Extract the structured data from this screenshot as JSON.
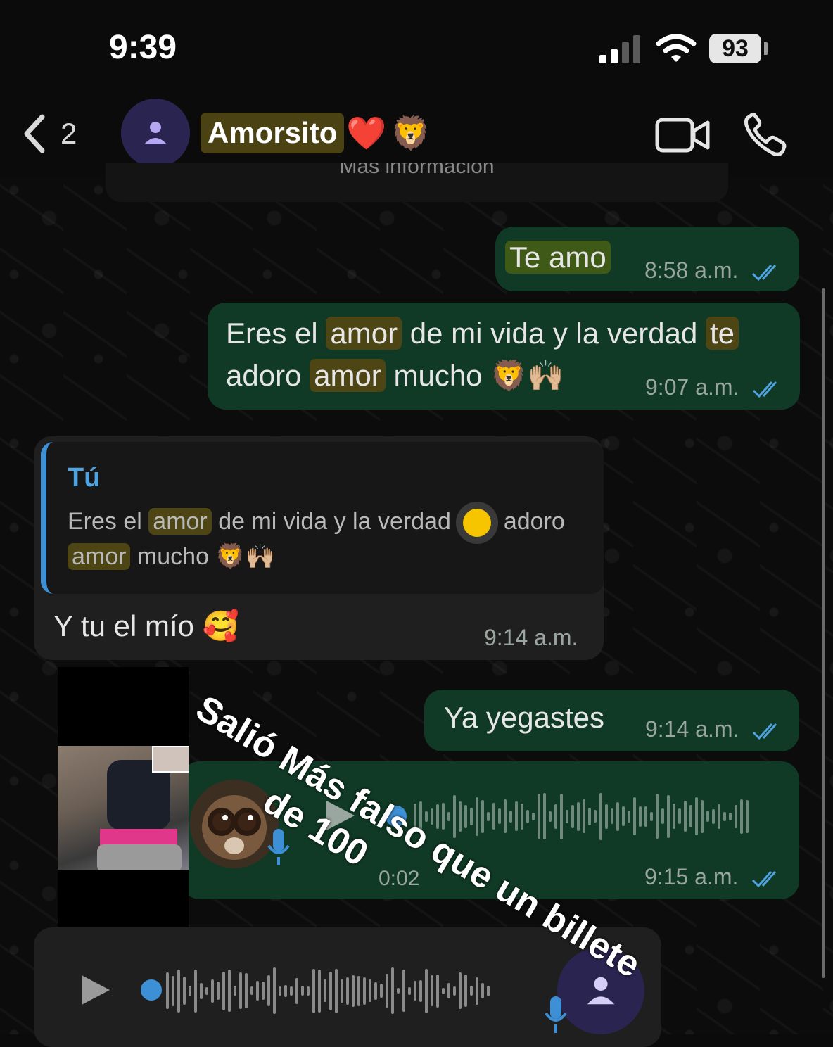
{
  "status_bar": {
    "time": "9:39",
    "battery": "93"
  },
  "header": {
    "back_count": "2",
    "contact_name": "Amorsito",
    "name_emojis": [
      "❤️",
      "🦁"
    ],
    "info_text": "Más información"
  },
  "messages": [
    {
      "direction": "out",
      "segments": [
        {
          "t": "Te amo",
          "hl": true
        }
      ],
      "time": "8:58 a.m."
    },
    {
      "direction": "out",
      "text": "Eres el amor de mi vida y la verdad te adoro amor mucho 🦁🙌🏼",
      "time": "9:07 a.m."
    },
    {
      "direction": "in",
      "reply_author": "Tú",
      "reply_text": "Eres el amor de mi vida y la verdad adoro amor mucho 🦁🙌🏼",
      "text": "Y tu el mío 🥰",
      "time": "9:14 a.m."
    },
    {
      "direction": "out",
      "text": "Ya yegastes",
      "time": "9:14 a.m."
    },
    {
      "direction": "out",
      "type": "voice",
      "duration": "0:02",
      "time": "9:15 a.m."
    }
  ],
  "msg2": {
    "l1a": "Eres el",
    "l1b": "amor",
    "l1c": "de mi vida y la verdad",
    "l1d": "te",
    "l2a": "adoro",
    "l2b": "amor",
    "l2c": "mucho 🦁🙌🏼"
  },
  "reply": {
    "l1a": "Eres el",
    "l1b": "amor",
    "l1c": "de mi vida y la verdad",
    "l1d": "adoro",
    "l2a": "amor",
    "l2b": "mucho 🦁🙌🏼"
  },
  "overlay": {
    "line1": "Salió Más falso que un billete",
    "line2": "de 100"
  },
  "colors": {
    "outgoing": "#103a26",
    "incoming": "#1f1f1f",
    "accent": "#4fa3e0",
    "highlight": "#4d4614"
  },
  "icons": [
    "back-chevron-icon",
    "person-icon",
    "video-icon",
    "phone-icon",
    "double-check-icon",
    "play-icon",
    "mic-icon"
  ]
}
